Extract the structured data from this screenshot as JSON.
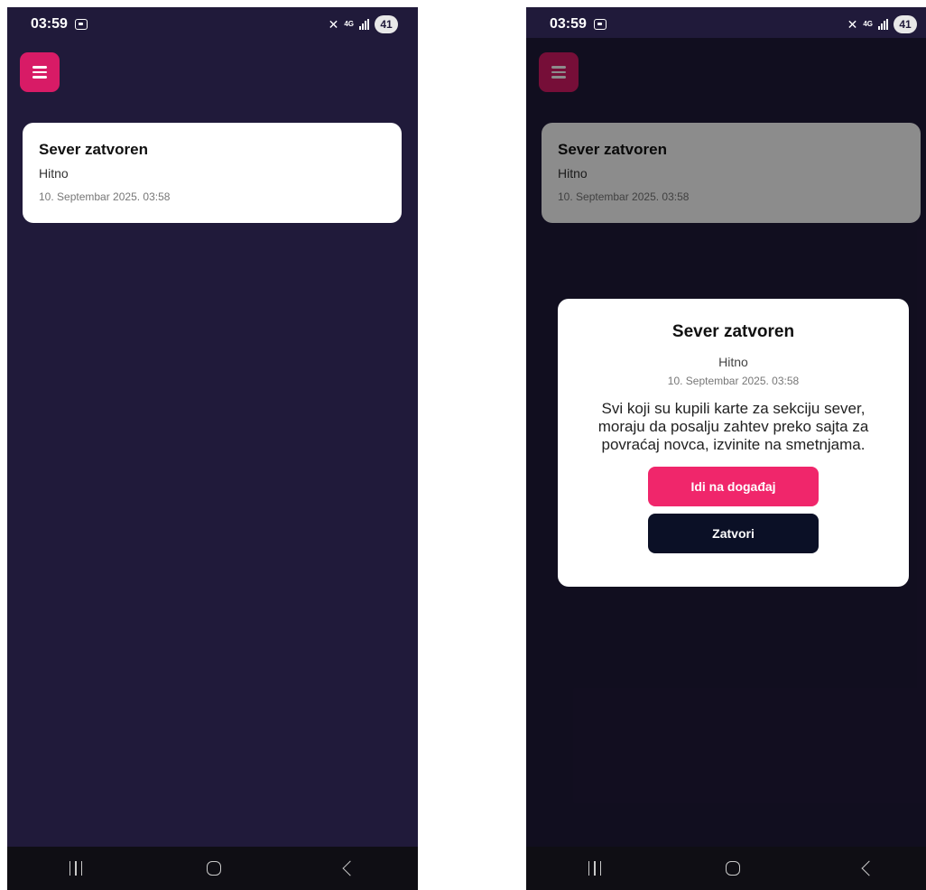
{
  "status_bar": {
    "time": "03:59",
    "network": "4G",
    "battery": "41"
  },
  "notification": {
    "title": "Sever zatvoren",
    "tag": "Hitno",
    "date": "10. Septembar 2025. 03:58"
  },
  "modal": {
    "title": "Sever zatvoren",
    "tag": "Hitno",
    "date": "10. Septembar 2025. 03:58",
    "message": "Svi koji su kupili karte za sekciju sever, moraju da posalju zahtev preko sajta za povraćaj novca, izvinite na smetnjama.",
    "primary_button": "Idi na događaj",
    "close_button": "Zatvori"
  },
  "colors": {
    "background": "#201a3a",
    "accent": "#f0266b",
    "menu_button": "#d81b66",
    "dark_button": "#0b1026"
  },
  "icons": [
    "menu-icon",
    "screenshot-icon",
    "mute-icon",
    "signal-icon",
    "battery-icon",
    "recent-apps-icon",
    "home-icon",
    "back-icon"
  ]
}
